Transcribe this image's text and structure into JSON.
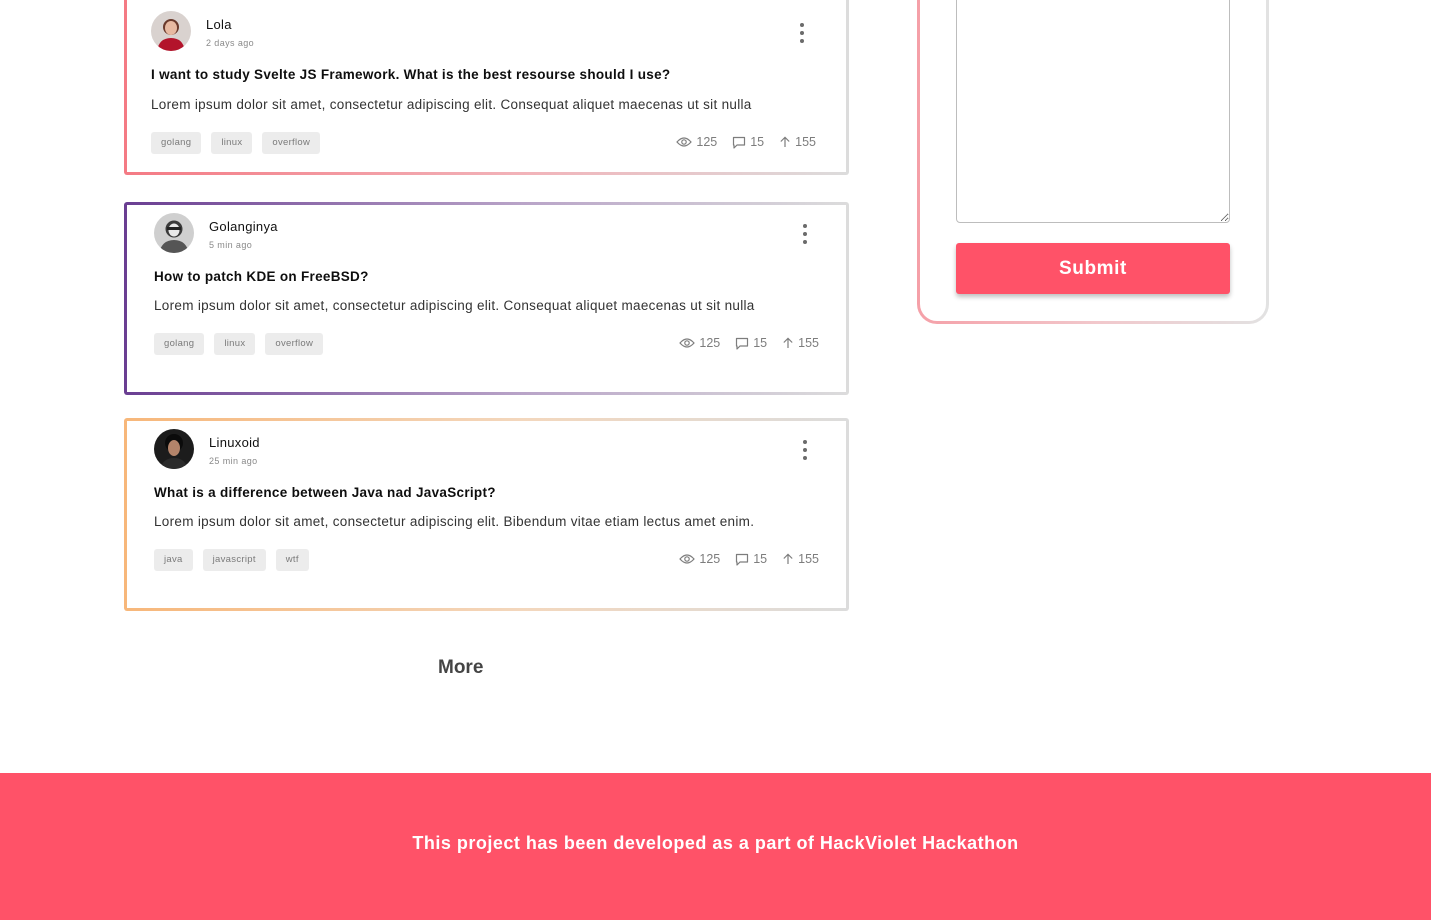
{
  "posts": [
    {
      "author": "Lola",
      "time": "2 days ago",
      "title": "I want to study Svelte JS Framework. What is the best resourse should I use?",
      "excerpt": "Lorem ipsum dolor sit amet, consectetur adipiscing elit. Consequat aliquet maecenas ut sit nulla",
      "tags": [
        "golang",
        "linux",
        "overflow"
      ],
      "views": "125",
      "comments": "15",
      "upvotes": "155",
      "accent": "#f47a84"
    },
    {
      "author": "Golanginya",
      "time": "5 min ago",
      "title": "How to patch KDE on FreeBSD?",
      "excerpt": "Lorem ipsum dolor sit amet, consectetur adipiscing elit. Consequat aliquet maecenas ut sit nulla",
      "tags": [
        "golang",
        "linux",
        "overflow"
      ],
      "views": "125",
      "comments": "15",
      "upvotes": "155",
      "accent": "#6a3e92"
    },
    {
      "author": "Linuxoid",
      "time": "25 min ago",
      "title": "What is a difference between Java nad JavaScript?",
      "excerpt": "Lorem ipsum dolor sit amet, consectetur adipiscing elit. Bibendum vitae etiam lectus amet enim.",
      "tags": [
        "java",
        "javascript",
        "wtf"
      ],
      "views": "125",
      "comments": "15",
      "upvotes": "155",
      "accent": "#f7b77a"
    }
  ],
  "sidebar": {
    "textarea_value": "",
    "submit_label": "Submit"
  },
  "more_label": "More",
  "footer": {
    "text": "This project has been developed as a part of HackViolet Hackathon"
  },
  "colors": {
    "brand": "#ff5268",
    "icon_gray": "#7d7d7d"
  },
  "icons": {
    "views": "eye-icon",
    "comments": "comment-icon",
    "upvotes": "arrow-up-icon",
    "menu": "more-vertical-icon"
  }
}
